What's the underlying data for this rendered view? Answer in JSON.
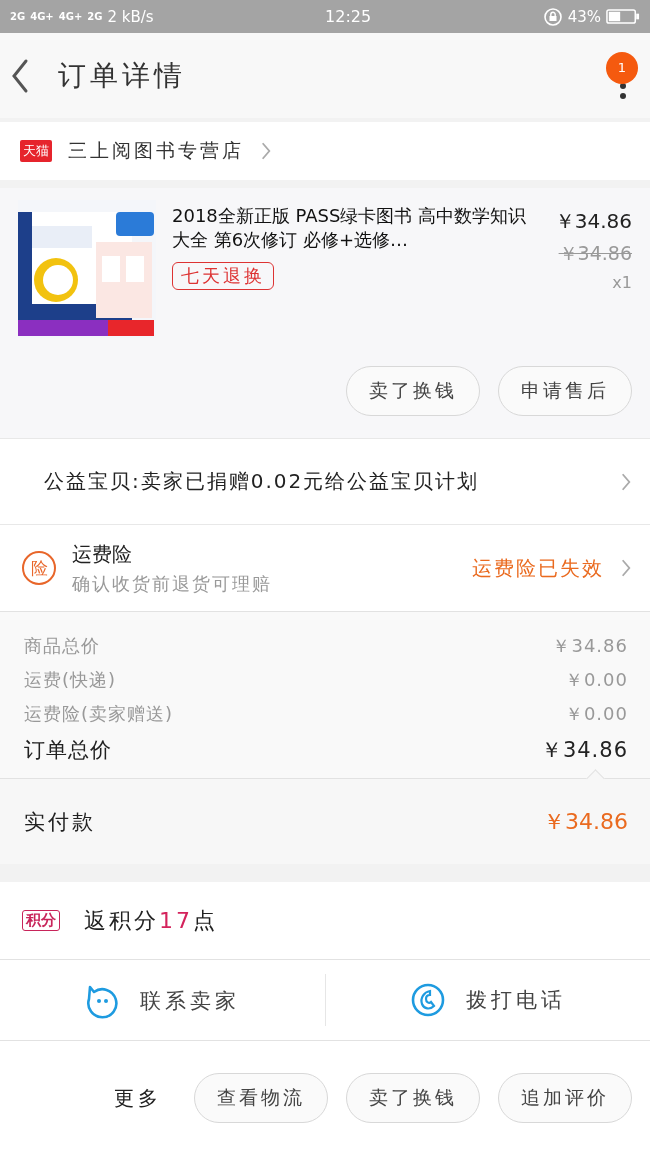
{
  "status_bar": {
    "network_labels": [
      "2G",
      "4G+",
      "4G+",
      "2G"
    ],
    "speed": "2 kB/s",
    "time": "12:25",
    "battery_percent": "43%"
  },
  "header": {
    "title": "订单详情",
    "notification_count": "1"
  },
  "shop": {
    "badge": "天猫",
    "name": "三上阅图书专营店"
  },
  "product": {
    "kind": "picture",
    "title": "2018全新正版 PASS绿卡图书 高中数学知识大全 第6次修订 必修+选修…",
    "price": "￥34.86",
    "original_price": "￥34.86",
    "quantity": "x1",
    "tag": "七天退换",
    "actions": [
      "卖了换钱",
      "申请售后"
    ]
  },
  "charity": {
    "text": "公益宝贝:卖家已捐赠0.02元给公益宝贝计划"
  },
  "insurance": {
    "icon_text": "险",
    "title": "运费险",
    "subtitle": "确认收货前退货可理赔",
    "status": "运费险已失效"
  },
  "costs": [
    {
      "kind": "minor",
      "label": "商品总价",
      "value": "￥34.86"
    },
    {
      "kind": "minor",
      "label": "运费(快递)",
      "value": "￥0.00"
    },
    {
      "kind": "minor",
      "label": "运费险(卖家赠送)",
      "value": "￥0.00"
    },
    {
      "kind": "total",
      "label": "订单总价",
      "value": "￥34.86"
    }
  ],
  "paid": {
    "label": "实付款",
    "value": "￥34.86"
  },
  "points": {
    "badge": "积分",
    "prefix": "返积分",
    "amount": "17",
    "suffix": "点"
  },
  "contacts": [
    {
      "kind": "chat",
      "label": "联系卖家"
    },
    {
      "kind": "phone",
      "label": "拨打电话"
    }
  ],
  "more": {
    "label": "更多",
    "buttons": [
      "查看物流",
      "卖了换钱",
      "追加评价"
    ]
  }
}
